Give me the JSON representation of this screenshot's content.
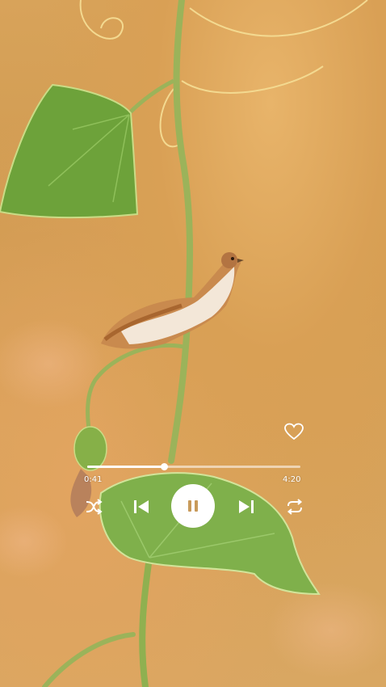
{
  "player": {
    "elapsed": "0:41",
    "duration": "4:20",
    "progress_fraction": 0.36,
    "is_playing": true,
    "liked": false,
    "icons": [
      "heart-icon",
      "shuffle-icon",
      "previous-icon",
      "pause-icon",
      "next-icon",
      "repeat-icon"
    ]
  },
  "colors": {
    "controls": "#ffffff",
    "pause_glyph": "#c89a5a"
  }
}
